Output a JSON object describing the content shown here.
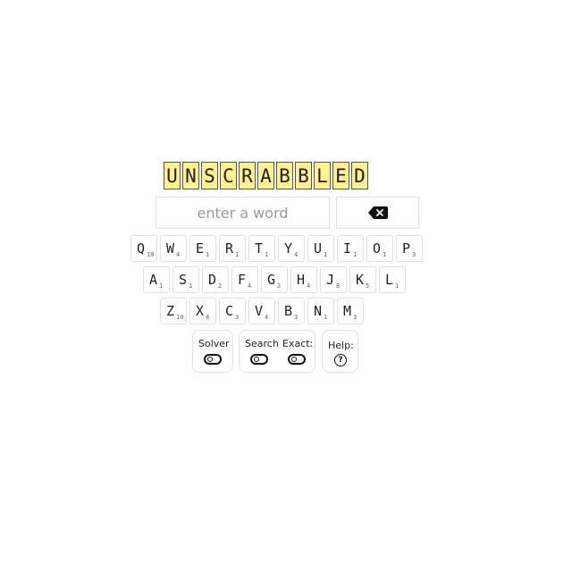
{
  "title": [
    "U",
    "N",
    "S",
    "C",
    "R",
    "A",
    "B",
    "B",
    "L",
    "E",
    "D"
  ],
  "input": {
    "placeholder": "enter a word"
  },
  "backspace": {
    "icon": "backspace-icon"
  },
  "keyboard": {
    "row1": [
      {
        "letter": "Q",
        "score": "10"
      },
      {
        "letter": "W",
        "score": "4"
      },
      {
        "letter": "E",
        "score": "1"
      },
      {
        "letter": "R",
        "score": "1"
      },
      {
        "letter": "T",
        "score": "1"
      },
      {
        "letter": "Y",
        "score": "4"
      },
      {
        "letter": "U",
        "score": "1"
      },
      {
        "letter": "I",
        "score": "1"
      },
      {
        "letter": "O",
        "score": "1"
      },
      {
        "letter": "P",
        "score": "3"
      }
    ],
    "row2": [
      {
        "letter": "A",
        "score": "1"
      },
      {
        "letter": "S",
        "score": "1"
      },
      {
        "letter": "D",
        "score": "2"
      },
      {
        "letter": "F",
        "score": "4"
      },
      {
        "letter": "G",
        "score": "2"
      },
      {
        "letter": "H",
        "score": "4"
      },
      {
        "letter": "J",
        "score": "8"
      },
      {
        "letter": "K",
        "score": "5"
      },
      {
        "letter": "L",
        "score": "1"
      }
    ],
    "row3": [
      {
        "letter": "Z",
        "score": "10"
      },
      {
        "letter": "X",
        "score": "8"
      },
      {
        "letter": "C",
        "score": "3"
      },
      {
        "letter": "V",
        "score": "4"
      },
      {
        "letter": "B",
        "score": "3"
      },
      {
        "letter": "N",
        "score": "1"
      },
      {
        "letter": "M",
        "score": "3"
      }
    ]
  },
  "controls": {
    "solver_label": "Solver",
    "search_label": "Search",
    "exact_label": "Exact:",
    "help_label": "Help:",
    "help_icon_glyph": "?"
  },
  "colors": {
    "tile_bg": "#fff18f",
    "border": "#e0e0e0"
  }
}
